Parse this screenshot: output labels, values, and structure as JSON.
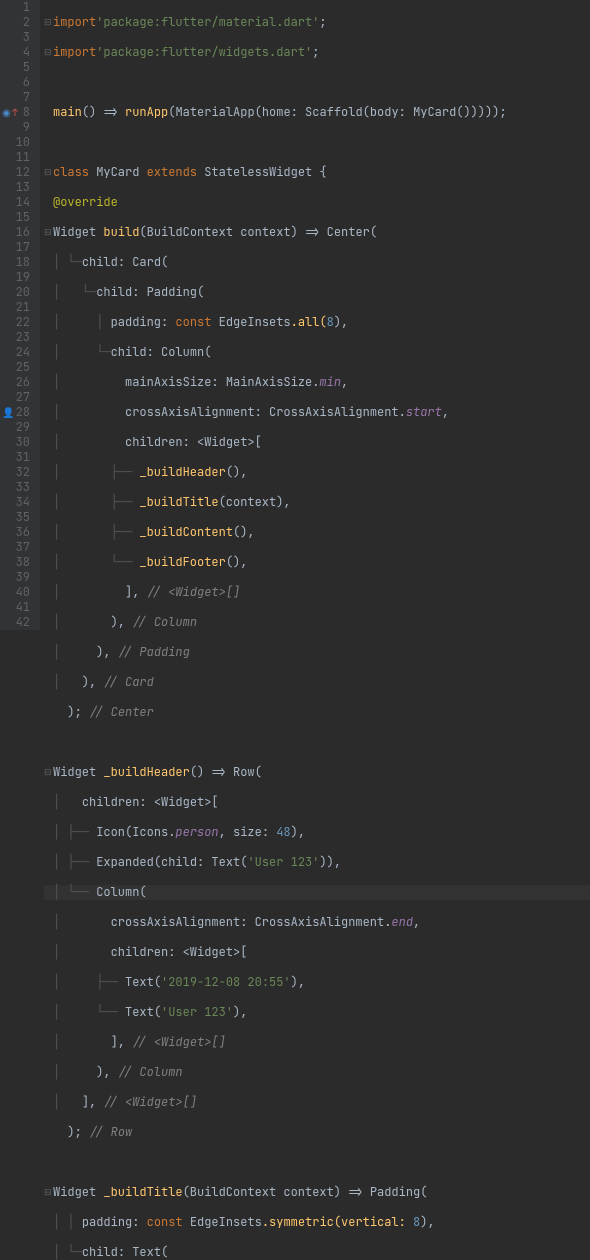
{
  "lines": {
    "l1": {
      "kw1": "import",
      "str": "'package:flutter/material.dart'",
      "semi": ";"
    },
    "l2": {
      "kw1": "import",
      "str": "'package:flutter/widgets.dart'",
      "semi": ";"
    },
    "l4": {
      "main": "main",
      "arrow": " => ",
      "run": "runApp",
      "matapp": "MaterialApp",
      "home": "home: ",
      "scaf": "Scaffold",
      "body": "body: ",
      "mycard": "MyCard",
      "tail": "()))));"
    },
    "l6": {
      "cls": "class ",
      "name": "MyCard",
      "ext": " extends ",
      "sw": "StatelessWidget",
      "brace": " {"
    },
    "l7": {
      "ann": "@override"
    },
    "l8": {
      "wtype": "Widget ",
      "build": "build",
      "ctx": "(BuildContext context)",
      "arrow": " => ",
      "center": "Center",
      "open": "("
    },
    "l9": {
      "child": "child: ",
      "card": "Card",
      "open": "("
    },
    "l10": {
      "child": "child: ",
      "pad": "Padding",
      "open": "("
    },
    "l11": {
      "padlbl": "padding: ",
      "cst": "const ",
      "ei": "EdgeInsets",
      "all": ".all(",
      "n": "8",
      "close": "),"
    },
    "l12": {
      "child": "child: ",
      "col": "Column",
      "open": "("
    },
    "l13": {
      "lbl": "mainAxisSize: MainAxisSize.",
      "val": "min",
      "comma": ","
    },
    "l14": {
      "lbl": "crossAxisAlignment: CrossAxisAlignment.",
      "val": "start",
      "comma": ","
    },
    "l15": {
      "lbl": "children: <Widget>["
    },
    "l16": {
      "fn": "_buildHeader",
      "tail": "(),"
    },
    "l17": {
      "fn": "_buildTitle",
      "tail": "(context),"
    },
    "l18": {
      "fn": "_buildContent",
      "tail": "(),"
    },
    "l19": {
      "fn": "_buildFooter",
      "tail": "(),"
    },
    "l20": {
      "close": "], ",
      "cmt": "// <Widget>[]"
    },
    "l21": {
      "close": "), ",
      "cmt": "// Column"
    },
    "l22": {
      "close": "), ",
      "cmt": "// Padding"
    },
    "l23": {
      "close": "), ",
      "cmt": "// Card"
    },
    "l24": {
      "close": "); ",
      "cmt": "// Center"
    },
    "l26": {
      "wtype": "Widget ",
      "fn": "_buildHeader",
      "arrow": "() => ",
      "row": "Row",
      "open": "("
    },
    "l27": {
      "lbl": "children: <Widget>["
    },
    "l28": {
      "icon": "Icon",
      "open": "(Icons.",
      "person": "person",
      "size": ", size: ",
      "n": "48",
      "close": "),"
    },
    "l29": {
      "exp": "Expanded",
      "open": "(child: ",
      "txt": "Text",
      "topen": "(",
      "str": "'User 123'",
      "close": ")),"
    },
    "l30": {
      "col": "Column",
      "open": "("
    },
    "l31": {
      "lbl": "crossAxisAlignment: CrossAxisAlignment.",
      "val": "end",
      "comma": ","
    },
    "l32": {
      "lbl": "children: <Widget>["
    },
    "l33": {
      "txt": "Text",
      "open": "(",
      "str": "'2019-12-08 20:55'",
      "close": "),"
    },
    "l34": {
      "txt": "Text",
      "open": "(",
      "str": "'User 123'",
      "close": "),"
    },
    "l35": {
      "close": "], ",
      "cmt": "// <Widget>[]"
    },
    "l36": {
      "close": "), ",
      "cmt": "// Column"
    },
    "l37": {
      "close": "], ",
      "cmt": "// <Widget>[]"
    },
    "l38": {
      "close": "); ",
      "cmt": "// Row"
    },
    "l40": {
      "wtype": "Widget ",
      "fn": "_buildTitle",
      "ctx": "(BuildContext context)",
      "arrow": " => ",
      "pad": "Padding",
      "open": "("
    },
    "l41": {
      "padlbl": "padding: ",
      "cst": "const ",
      "ei": "EdgeInsets",
      "sym": ".symmetric(vertical: ",
      "n": "8",
      "close": "),"
    },
    "l42": {
      "child": "child: ",
      "txt": "Text",
      "open": "("
    }
  }
}
